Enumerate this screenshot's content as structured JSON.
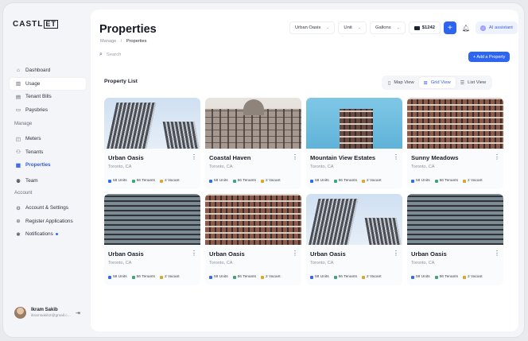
{
  "app": {
    "logo": "CASTLET",
    "logo_prefix": "CASTL",
    "logo_box": "ET"
  },
  "sidebar": {
    "items": [
      {
        "label": "Dashboard",
        "icon": "home-icon"
      },
      {
        "label": "Usage",
        "icon": "usage-icon"
      },
      {
        "label": "Tenant Bills",
        "icon": "bills-icon"
      },
      {
        "label": "Paysbries",
        "icon": "payments-icon"
      }
    ],
    "manage_label": "Manage",
    "manage_items": [
      {
        "label": "Meters",
        "icon": "meter-icon"
      },
      {
        "label": "Tenants",
        "icon": "tenants-icon"
      },
      {
        "label": "Properties",
        "icon": "building-icon"
      },
      {
        "label": "Team",
        "icon": "team-icon"
      }
    ],
    "account_label": "Account",
    "account_items": [
      {
        "label": "Account & Settings",
        "icon": "settings-icon"
      },
      {
        "label": "Register Applications",
        "icon": "register-icon"
      },
      {
        "label": "Notifications",
        "icon": "notification-icon"
      }
    ],
    "user": {
      "name": "Ikram Sakib",
      "email": "ikramsakib2@gmail.c..."
    }
  },
  "header": {
    "title": "Properties",
    "breadcrumb": [
      "Manage",
      "Properties"
    ],
    "property_select": "Urban Oasis",
    "unit_select": "Unit",
    "measure_select": "Gallons",
    "balance": "$1242",
    "ai_label": "AI assistant"
  },
  "search": {
    "placeholder": "Search"
  },
  "add_button": "+ Add a Property",
  "list": {
    "title": "Property List",
    "views": [
      "Map View",
      "Grid View",
      "List View"
    ],
    "active_view": "Grid View"
  },
  "colors": {
    "accent": "#2d64f0",
    "units": "#2f6cf0",
    "tenants": "#3aa77a",
    "vacant": "#e0a42b"
  },
  "properties": [
    {
      "name": "Urban Oasis",
      "location": "Toronto, CA",
      "units": "58 Units",
      "tenants": "56 Tenants",
      "vacant": "2 Vacant"
    },
    {
      "name": "Coastal Haven",
      "location": "Toronto, CA",
      "units": "58 Units",
      "tenants": "56 Tenants",
      "vacant": "2 Vacant"
    },
    {
      "name": "Mountain View Estates",
      "location": "Toronto, CA",
      "units": "58 Units",
      "tenants": "56 Tenants",
      "vacant": "2 Vacant"
    },
    {
      "name": "Sunny Meadows",
      "location": "Toronto, CA",
      "units": "58 Units",
      "tenants": "56 Tenants",
      "vacant": "2 Vacant"
    },
    {
      "name": "Urban Oasis",
      "location": "Toronto, CA",
      "units": "58 Units",
      "tenants": "56 Tenants",
      "vacant": "2 Vacant"
    },
    {
      "name": "Urban Oasis",
      "location": "Toronto, CA",
      "units": "58 Units",
      "tenants": "56 Tenants",
      "vacant": "2 Vacant"
    },
    {
      "name": "Urban Oasis",
      "location": "Toronto, CA",
      "units": "58 Units",
      "tenants": "56 Tenants",
      "vacant": "2 Vacant"
    },
    {
      "name": "Urban Oasis",
      "location": "Toronto, CA",
      "units": "58 Units",
      "tenants": "56 Tenants",
      "vacant": "2 Vacant"
    }
  ]
}
